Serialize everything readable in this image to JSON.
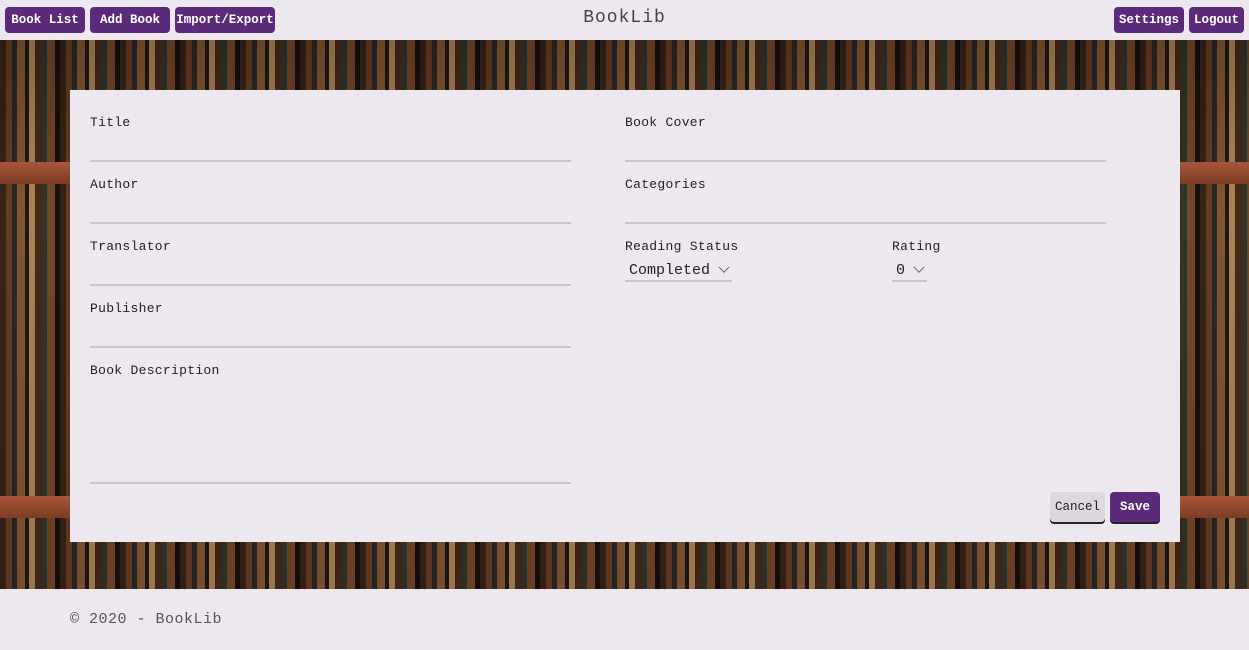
{
  "nav": {
    "book_list": "Book List",
    "add_book": "Add Book",
    "import_export": "Import/Export",
    "settings": "Settings",
    "logout": "Logout",
    "brand": "BookLib"
  },
  "form": {
    "title_label": "Title",
    "author_label": "Author",
    "translator_label": "Translator",
    "publisher_label": "Publisher",
    "description_label": "Book Description",
    "cover_label": "Book Cover",
    "categories_label": "Categories",
    "reading_status_label": "Reading Status",
    "reading_status_value": "Completed",
    "rating_label": "Rating",
    "rating_value": "0",
    "cancel_label": "Cancel",
    "save_label": "Save"
  },
  "footer": {
    "copyright": "© 2020 - BookLib"
  },
  "colors": {
    "accent": "#5c2a7a",
    "background": "#ede8ef"
  }
}
